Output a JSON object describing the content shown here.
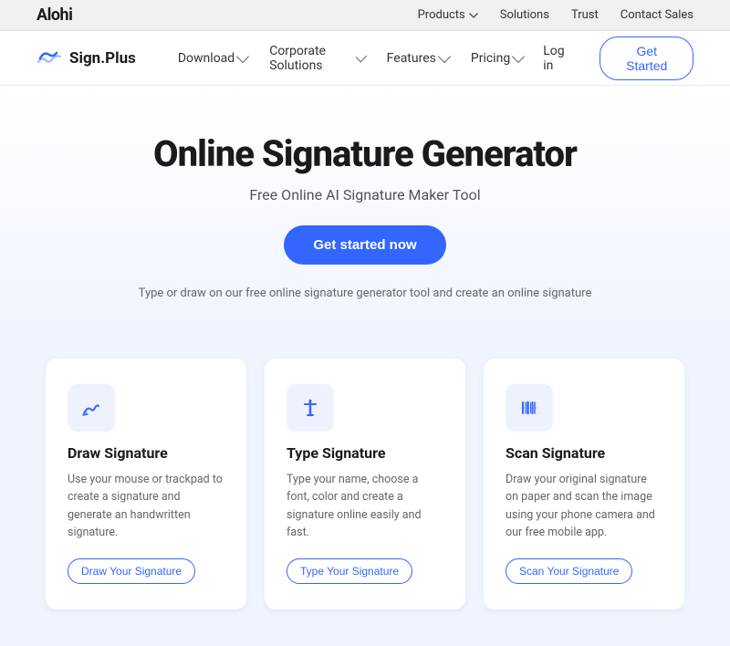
{
  "topbar": {
    "logo": "Alohi",
    "nav": [
      {
        "label": "Products",
        "has_dropdown": true
      },
      {
        "label": "Solutions",
        "has_dropdown": false
      },
      {
        "label": "Trust",
        "has_dropdown": false
      },
      {
        "label": "Contact Sales",
        "has_dropdown": false
      }
    ]
  },
  "mainnav": {
    "brand": "Sign.Plus",
    "links": [
      {
        "label": "Download",
        "has_dropdown": true
      },
      {
        "label": "Corporate Solutions",
        "has_dropdown": true
      },
      {
        "label": "Features",
        "has_dropdown": true
      },
      {
        "label": "Pricing",
        "has_dropdown": true
      }
    ],
    "login_label": "Log in",
    "cta_label": "Get Started"
  },
  "hero": {
    "title": "Online Signature Generator",
    "subtitle": "Free Online AI Signature Maker Tool",
    "cta": "Get started now",
    "description": "Type or draw on our free online signature generator tool and create an online signature"
  },
  "cards": [
    {
      "icon": "draw",
      "title": "Draw Signature",
      "description": "Use your mouse or trackpad to create a signature and generate an handwritten signature.",
      "button": "Draw Your Signature"
    },
    {
      "icon": "type",
      "title": "Type Signature",
      "description": "Type your name, choose a font, color and create a signature online easily and fast.",
      "button": "Type Your Signature"
    },
    {
      "icon": "scan",
      "title": "Scan Signature",
      "description": "Draw your original signature on paper and scan the image using your phone camera and our free mobile app.",
      "button": "Scan Your Signature"
    }
  ]
}
